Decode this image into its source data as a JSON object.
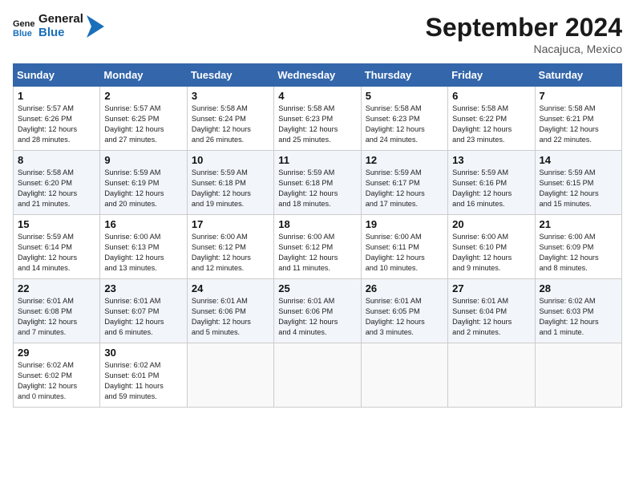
{
  "header": {
    "logo_line1": "General",
    "logo_line2": "Blue",
    "month": "September 2024",
    "location": "Nacajuca, Mexico"
  },
  "days_of_week": [
    "Sunday",
    "Monday",
    "Tuesday",
    "Wednesday",
    "Thursday",
    "Friday",
    "Saturday"
  ],
  "weeks": [
    [
      {
        "day": "1",
        "content": "Sunrise: 5:57 AM\nSunset: 6:26 PM\nDaylight: 12 hours\nand 28 minutes."
      },
      {
        "day": "2",
        "content": "Sunrise: 5:57 AM\nSunset: 6:25 PM\nDaylight: 12 hours\nand 27 minutes."
      },
      {
        "day": "3",
        "content": "Sunrise: 5:58 AM\nSunset: 6:24 PM\nDaylight: 12 hours\nand 26 minutes."
      },
      {
        "day": "4",
        "content": "Sunrise: 5:58 AM\nSunset: 6:23 PM\nDaylight: 12 hours\nand 25 minutes."
      },
      {
        "day": "5",
        "content": "Sunrise: 5:58 AM\nSunset: 6:23 PM\nDaylight: 12 hours\nand 24 minutes."
      },
      {
        "day": "6",
        "content": "Sunrise: 5:58 AM\nSunset: 6:22 PM\nDaylight: 12 hours\nand 23 minutes."
      },
      {
        "day": "7",
        "content": "Sunrise: 5:58 AM\nSunset: 6:21 PM\nDaylight: 12 hours\nand 22 minutes."
      }
    ],
    [
      {
        "day": "8",
        "content": "Sunrise: 5:58 AM\nSunset: 6:20 PM\nDaylight: 12 hours\nand 21 minutes."
      },
      {
        "day": "9",
        "content": "Sunrise: 5:59 AM\nSunset: 6:19 PM\nDaylight: 12 hours\nand 20 minutes."
      },
      {
        "day": "10",
        "content": "Sunrise: 5:59 AM\nSunset: 6:18 PM\nDaylight: 12 hours\nand 19 minutes."
      },
      {
        "day": "11",
        "content": "Sunrise: 5:59 AM\nSunset: 6:18 PM\nDaylight: 12 hours\nand 18 minutes."
      },
      {
        "day": "12",
        "content": "Sunrise: 5:59 AM\nSunset: 6:17 PM\nDaylight: 12 hours\nand 17 minutes."
      },
      {
        "day": "13",
        "content": "Sunrise: 5:59 AM\nSunset: 6:16 PM\nDaylight: 12 hours\nand 16 minutes."
      },
      {
        "day": "14",
        "content": "Sunrise: 5:59 AM\nSunset: 6:15 PM\nDaylight: 12 hours\nand 15 minutes."
      }
    ],
    [
      {
        "day": "15",
        "content": "Sunrise: 5:59 AM\nSunset: 6:14 PM\nDaylight: 12 hours\nand 14 minutes."
      },
      {
        "day": "16",
        "content": "Sunrise: 6:00 AM\nSunset: 6:13 PM\nDaylight: 12 hours\nand 13 minutes."
      },
      {
        "day": "17",
        "content": "Sunrise: 6:00 AM\nSunset: 6:12 PM\nDaylight: 12 hours\nand 12 minutes."
      },
      {
        "day": "18",
        "content": "Sunrise: 6:00 AM\nSunset: 6:12 PM\nDaylight: 12 hours\nand 11 minutes."
      },
      {
        "day": "19",
        "content": "Sunrise: 6:00 AM\nSunset: 6:11 PM\nDaylight: 12 hours\nand 10 minutes."
      },
      {
        "day": "20",
        "content": "Sunrise: 6:00 AM\nSunset: 6:10 PM\nDaylight: 12 hours\nand 9 minutes."
      },
      {
        "day": "21",
        "content": "Sunrise: 6:00 AM\nSunset: 6:09 PM\nDaylight: 12 hours\nand 8 minutes."
      }
    ],
    [
      {
        "day": "22",
        "content": "Sunrise: 6:01 AM\nSunset: 6:08 PM\nDaylight: 12 hours\nand 7 minutes."
      },
      {
        "day": "23",
        "content": "Sunrise: 6:01 AM\nSunset: 6:07 PM\nDaylight: 12 hours\nand 6 minutes."
      },
      {
        "day": "24",
        "content": "Sunrise: 6:01 AM\nSunset: 6:06 PM\nDaylight: 12 hours\nand 5 minutes."
      },
      {
        "day": "25",
        "content": "Sunrise: 6:01 AM\nSunset: 6:06 PM\nDaylight: 12 hours\nand 4 minutes."
      },
      {
        "day": "26",
        "content": "Sunrise: 6:01 AM\nSunset: 6:05 PM\nDaylight: 12 hours\nand 3 minutes."
      },
      {
        "day": "27",
        "content": "Sunrise: 6:01 AM\nSunset: 6:04 PM\nDaylight: 12 hours\nand 2 minutes."
      },
      {
        "day": "28",
        "content": "Sunrise: 6:02 AM\nSunset: 6:03 PM\nDaylight: 12 hours\nand 1 minute."
      }
    ],
    [
      {
        "day": "29",
        "content": "Sunrise: 6:02 AM\nSunset: 6:02 PM\nDaylight: 12 hours\nand 0 minutes."
      },
      {
        "day": "30",
        "content": "Sunrise: 6:02 AM\nSunset: 6:01 PM\nDaylight: 11 hours\nand 59 minutes."
      },
      {
        "day": "",
        "content": ""
      },
      {
        "day": "",
        "content": ""
      },
      {
        "day": "",
        "content": ""
      },
      {
        "day": "",
        "content": ""
      },
      {
        "day": "",
        "content": ""
      }
    ]
  ]
}
